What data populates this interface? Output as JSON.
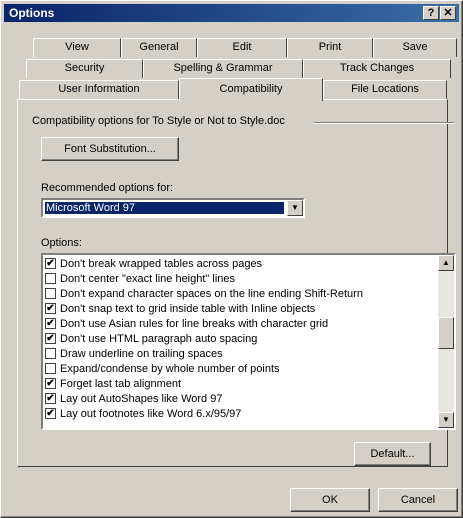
{
  "window": {
    "title": "Options",
    "help_label": "?",
    "close_label": "✕"
  },
  "tabs": {
    "row1": [
      {
        "label": "View"
      },
      {
        "label": "General"
      },
      {
        "label": "Edit"
      },
      {
        "label": "Print"
      },
      {
        "label": "Save"
      }
    ],
    "row2": [
      {
        "label": "Security"
      },
      {
        "label": "Spelling & Grammar"
      },
      {
        "label": "Track Changes"
      }
    ],
    "row3": [
      {
        "label": "User Information"
      },
      {
        "label": "Compatibility"
      },
      {
        "label": "File Locations"
      }
    ],
    "active": "Compatibility"
  },
  "compat": {
    "group_label": "Compatibility options for To Style or Not to Style.doc",
    "font_sub_button": "Font Substitution...",
    "recommended_label": "Recommended options for:",
    "recommended_value": "Microsoft Word 97",
    "options_label": "Options:",
    "options": [
      {
        "label": "Don't break wrapped tables across pages",
        "checked": true
      },
      {
        "label": "Don't center \"exact line height\" lines",
        "checked": false
      },
      {
        "label": "Don't expand character spaces on the line ending Shift-Return",
        "checked": false
      },
      {
        "label": "Don't snap text to grid inside table with Inline objects",
        "checked": true
      },
      {
        "label": "Don't use Asian rules for line breaks with character grid",
        "checked": true
      },
      {
        "label": "Don't use HTML paragraph auto spacing",
        "checked": true
      },
      {
        "label": "Draw underline on trailing spaces",
        "checked": false
      },
      {
        "label": "Expand/condense by whole number of points",
        "checked": false
      },
      {
        "label": "Forget last tab alignment",
        "checked": true
      },
      {
        "label": "Lay out AutoShapes like Word 97",
        "checked": true
      },
      {
        "label": "Lay out footnotes like Word 6.x/95/97",
        "checked": true
      }
    ],
    "default_button": "Default..."
  },
  "footer": {
    "ok": "OK",
    "cancel": "Cancel"
  },
  "icons": {
    "check": "✔",
    "arrow_up": "▲",
    "arrow_down": "▼"
  },
  "colors": {
    "face": "#d4d0c8",
    "title_start": "#0a246a",
    "title_end": "#3a6ea5",
    "selection": "#0a246a"
  }
}
